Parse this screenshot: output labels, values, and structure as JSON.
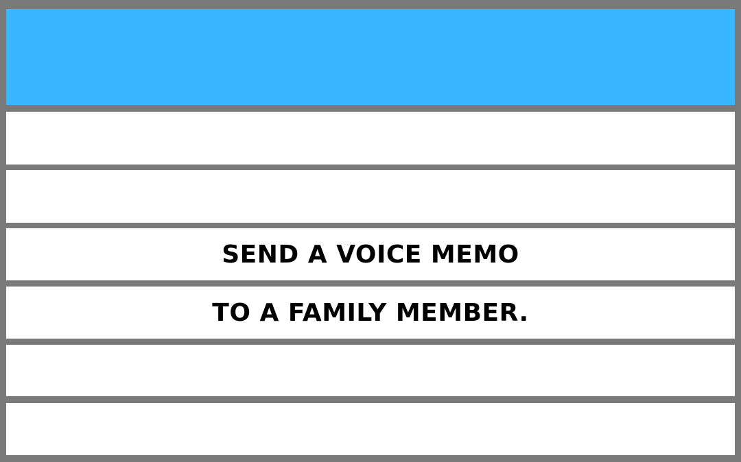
{
  "colors": {
    "header_band": "#38b6ff",
    "border": "#7a7a7a",
    "row_background": "#ffffff",
    "text": "#000000"
  },
  "rows": [
    {
      "text": ""
    },
    {
      "text": ""
    },
    {
      "text": "SEND A VOICE MEMO"
    },
    {
      "text": "TO A FAMILY MEMBER."
    },
    {
      "text": ""
    },
    {
      "text": ""
    }
  ]
}
